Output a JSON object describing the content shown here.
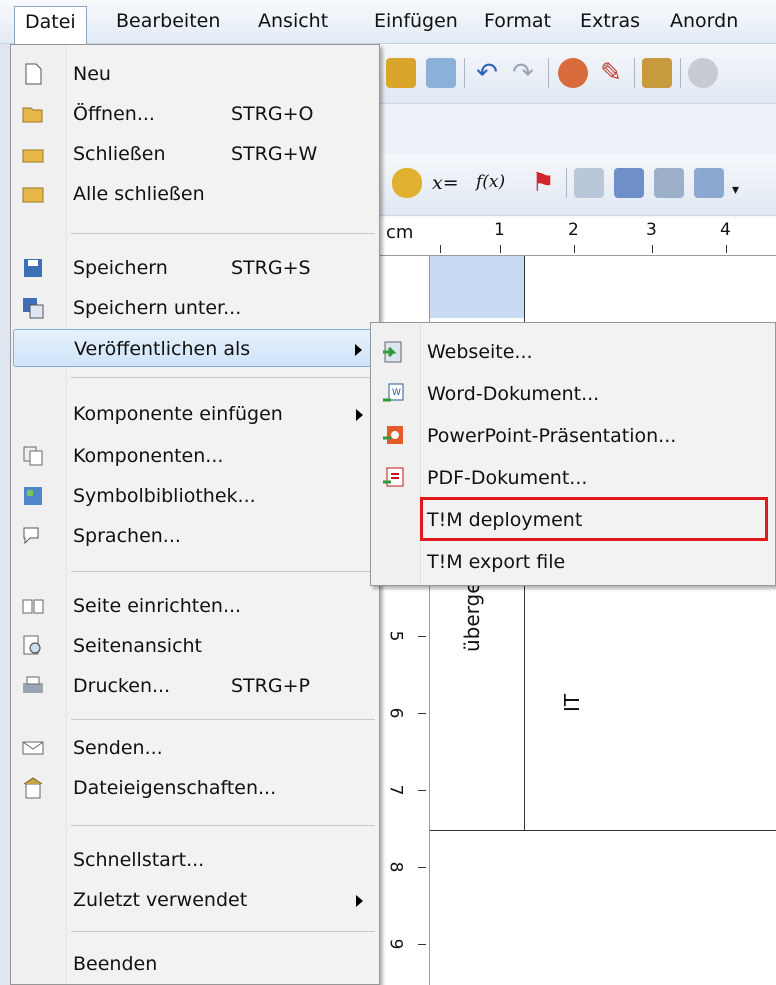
{
  "menubar": {
    "items": [
      "Datei",
      "Bearbeiten",
      "Ansicht",
      "Einfügen",
      "Format",
      "Extras",
      "Anordn"
    ]
  },
  "file_menu": {
    "items": [
      {
        "label": "Neu",
        "shortcut": "",
        "icon": "new-document-icon"
      },
      {
        "label": "Öffnen...",
        "shortcut": "STRG+O",
        "icon": "open-folder-icon"
      },
      {
        "label": "Schließen",
        "shortcut": "STRG+W",
        "icon": "close-folder-icon"
      },
      {
        "label": "Alle schließen",
        "shortcut": "",
        "icon": "close-all-icon"
      },
      {
        "label": "Speichern",
        "shortcut": "STRG+S",
        "icon": "save-icon"
      },
      {
        "label": "Speichern unter...",
        "shortcut": "",
        "icon": "save-as-icon"
      },
      {
        "label": "Veröffentlichen als",
        "shortcut": "",
        "icon": "",
        "submenu": true
      },
      {
        "label": "Komponente einfügen",
        "shortcut": "",
        "icon": "",
        "submenu": true
      },
      {
        "label": "Komponenten...",
        "shortcut": "",
        "icon": "components-icon"
      },
      {
        "label": "Symbolbibliothek...",
        "shortcut": "",
        "icon": "symbol-library-icon"
      },
      {
        "label": "Sprachen...",
        "shortcut": "",
        "icon": "languages-icon"
      },
      {
        "label": "Seite einrichten...",
        "shortcut": "",
        "icon": "page-setup-icon"
      },
      {
        "label": "Seitenansicht",
        "shortcut": "",
        "icon": "print-preview-icon"
      },
      {
        "label": "Drucken...",
        "shortcut": "STRG+P",
        "icon": "print-icon"
      },
      {
        "label": "Senden...",
        "shortcut": "",
        "icon": "send-icon"
      },
      {
        "label": "Dateieigenschaften...",
        "shortcut": "",
        "icon": "file-properties-icon"
      },
      {
        "label": "Schnellstart...",
        "shortcut": "",
        "icon": ""
      },
      {
        "label": "Zuletzt verwendet",
        "shortcut": "",
        "icon": "",
        "submenu": true
      },
      {
        "label": "Beenden",
        "shortcut": "",
        "icon": ""
      }
    ]
  },
  "publish_submenu": {
    "items": [
      {
        "label": "Webseite...",
        "icon": "webpage-export-icon"
      },
      {
        "label": "Word-Dokument...",
        "icon": "word-export-icon"
      },
      {
        "label": "PowerPoint-Präsentation...",
        "icon": "powerpoint-export-icon"
      },
      {
        "label": "PDF-Dokument...",
        "icon": "pdf-export-icon"
      },
      {
        "label": "T!M deployment",
        "icon": ""
      },
      {
        "label": "T!M export file",
        "icon": ""
      }
    ],
    "highlighted_item": "T!M deployment",
    "highlight_color": "#e0191e"
  },
  "toolbar": {
    "formula_label": "x=",
    "function_label": "f(x)"
  },
  "ruler": {
    "unit": "cm",
    "h_labels": [
      "1",
      "2",
      "3",
      "4"
    ],
    "v_labels": [
      "5",
      "6",
      "7",
      "8",
      "9"
    ]
  },
  "diagram": {
    "lane_header_text": "überge",
    "lane_text": "IT"
  },
  "colors": {
    "menu_highlight": "#cfe4f9",
    "menu_border": "#84acdd",
    "lane_header_fill": "#c9dbf2"
  }
}
